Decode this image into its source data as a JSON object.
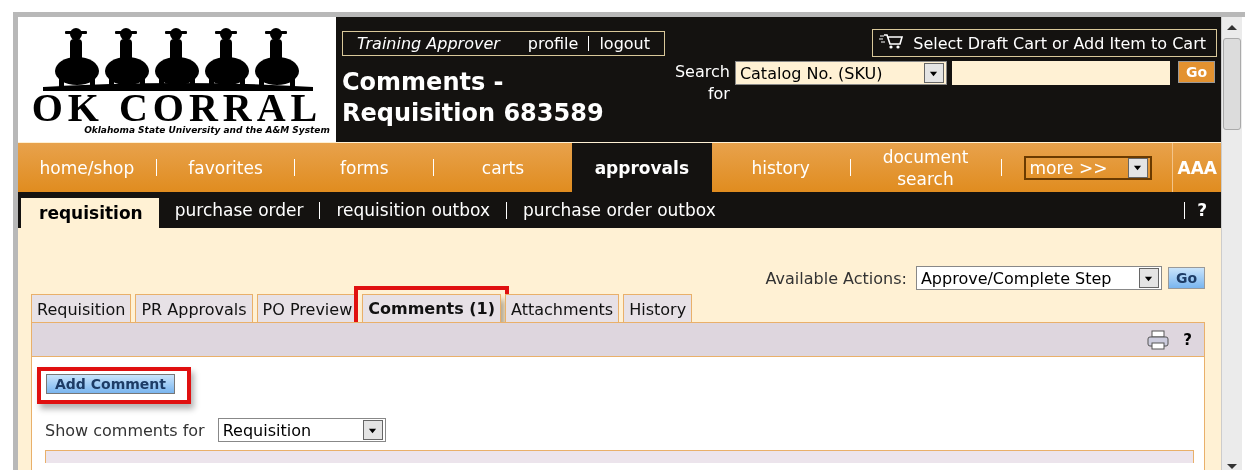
{
  "logo": {
    "title": "OK CORRAL",
    "subtitle": "Oklahoma State University and the A&M System"
  },
  "user_box": {
    "role": "Training Approver",
    "links": [
      "profile",
      "logout"
    ]
  },
  "page_title": [
    "Comments -",
    "Requisition 683589"
  ],
  "cart_button": {
    "label": "Select Draft Cart or Add Item to Cart"
  },
  "search": {
    "label": "Search for",
    "type_value": "Catalog No. (SKU)",
    "go": "Go"
  },
  "nav": {
    "items": [
      {
        "label": "home/shop",
        "selected": false
      },
      {
        "label": "favorites",
        "selected": false
      },
      {
        "label": "forms",
        "selected": false
      },
      {
        "label": "carts",
        "selected": false
      },
      {
        "label": "approvals",
        "selected": true
      },
      {
        "label": "history",
        "selected": false
      },
      {
        "label": "document search",
        "selected": false
      }
    ],
    "more": "more >>",
    "text_size": "AAA"
  },
  "subnav": {
    "items": [
      {
        "label": "requisition",
        "selected": true
      },
      {
        "label": "purchase order",
        "selected": false
      },
      {
        "label": "requisition outbox",
        "selected": false
      },
      {
        "label": "purchase order outbox",
        "selected": false
      }
    ],
    "help": "?"
  },
  "actions": {
    "label": "Available Actions:",
    "value": "Approve/Complete Step",
    "go": "Go"
  },
  "tabs": [
    {
      "label": "Requisition",
      "selected": false,
      "highlighted": false
    },
    {
      "label": "PR Approvals",
      "selected": false,
      "highlighted": false
    },
    {
      "label": "PO Preview",
      "selected": false,
      "highlighted": false
    },
    {
      "label": "Comments (1)",
      "selected": true,
      "highlighted": true
    },
    {
      "label": "Attachments",
      "selected": false,
      "highlighted": false
    },
    {
      "label": "History",
      "selected": false,
      "highlighted": false
    }
  ],
  "toolbar": {
    "help": "?"
  },
  "add_comment": {
    "label": "Add Comment",
    "highlighted": true
  },
  "show_comments": {
    "label": "Show comments for",
    "value": "Requisition"
  }
}
